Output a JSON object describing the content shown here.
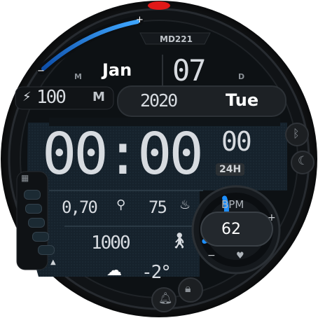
{
  "watch": {
    "model": "MD221",
    "month_label": "M",
    "month": "Jan",
    "day_label": "D",
    "day": "07",
    "battery": "100",
    "brand_mark": "M",
    "year": "2020",
    "weekday": "Tue",
    "time": "00:00",
    "seconds": "00",
    "format": "24H",
    "distance": "0,70",
    "calories": "75",
    "steps": "1000",
    "temperature": "-2°",
    "bpm_label": "BPM",
    "bpm": "62",
    "plus": "+",
    "minus": "−",
    "heart_level": 0.6,
    "icons": {
      "battery": "lightning-icon",
      "location": "location-pin-icon",
      "calories": "flame-icon",
      "steps": "walking-person-icon",
      "weather": "rain-cloud-icon",
      "heart": "heart-icon",
      "bluetooth": "bluetooth-icon",
      "night": "moon-icon",
      "alarm": "bell-icon",
      "lock": "lock-icon",
      "apps": "grid-icon"
    },
    "colors": {
      "accent": "#1e8fff",
      "text": "#d7dbe0",
      "dial": "#14191e",
      "top_led": "#e01818"
    }
  }
}
